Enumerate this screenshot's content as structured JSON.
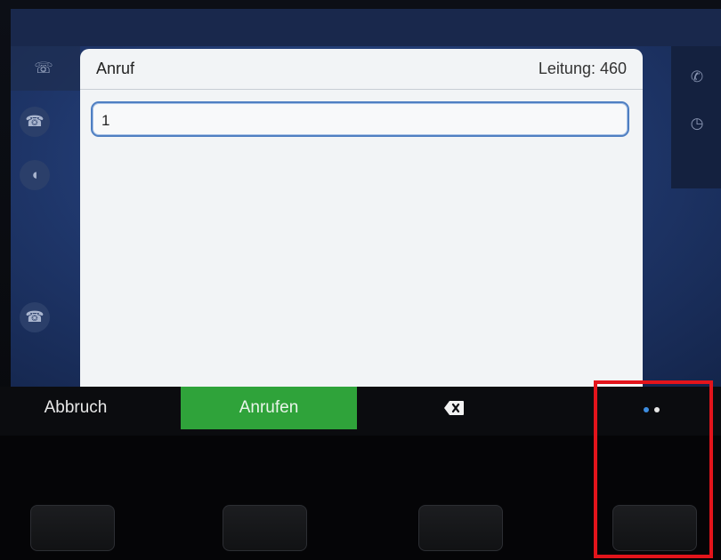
{
  "dialog": {
    "title": "Anruf",
    "line_label": "Leitung: 460",
    "number_value": "1"
  },
  "softkeys": {
    "cancel_label": "Abbruch",
    "call_label": "Anrufen",
    "backspace_icon": "backspace-icon",
    "more_icon": "page-dots-icon"
  },
  "colors": {
    "call_button": "#2fa33a",
    "highlight": "#e3141b",
    "field_border": "#4f7fc2",
    "active_dot": "#3d8de0"
  },
  "background_icons": {
    "left": [
      "phone-icon",
      "hangup-icon",
      "speaker-icon",
      "voicemail-icon"
    ],
    "right": [
      "phone-icon",
      "clock-icon"
    ]
  }
}
